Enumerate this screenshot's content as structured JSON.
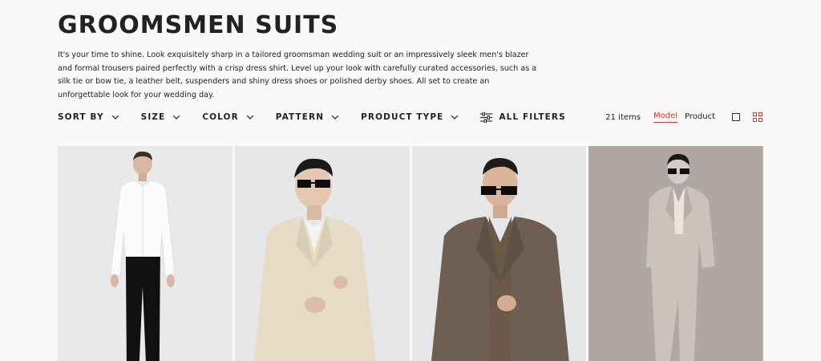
{
  "page": {
    "title": "GROOMSMEN SUITS",
    "description": "It's your time to shine. Look exquisitely sharp in a tailored groomsman wedding suit or an impressively sleek men's blazer and formal trousers paired perfectly with a crisp dress shirt. Level up your look with carefully curated accessories, such as a silk tie or bow tie, a leather belt, suspenders and shiny dress shoes or polished derby shoes. All set to create an unforgettable look for your wedding day."
  },
  "filters": {
    "sort_by": "SORT BY",
    "size": "SIZE",
    "color": "COLOR",
    "pattern": "PATTERN",
    "product_type": "PRODUCT TYPE",
    "all_filters": "ALL FILTERS"
  },
  "view": {
    "item_count": "21 items",
    "model_label": "Model",
    "product_label": "Product",
    "active_view": "Model",
    "active_grid": "four-column"
  },
  "products": [
    {
      "image": "model in white dress shirt and black trousers"
    },
    {
      "image": "model in cream linen blazer and sunglasses"
    },
    {
      "image": "model in brown suit and sunglasses"
    },
    {
      "image": "model in taupe suit, black and white photo"
    }
  ],
  "colors": {
    "accent": "#d23c2a",
    "background": "#faf9f8",
    "text": "#222222"
  }
}
